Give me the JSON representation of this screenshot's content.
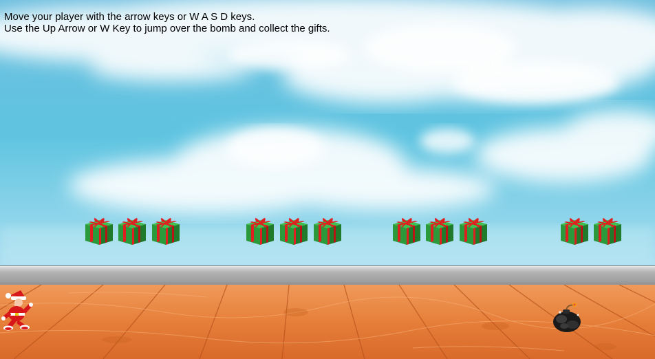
{
  "instructions": {
    "line1": "Move your player with the arrow keys or W A S D keys.",
    "line2": "Use the Up Arrow or W Key to jump over the bomb and collect the gifts."
  },
  "colors": {
    "sky_top": "#7cc4e0",
    "sky_bottom": "#b8e4f0",
    "floor": "#e07a3a",
    "gift_box": "#2a9a3a",
    "gift_ribbon": "#e02020"
  },
  "sprites": {
    "player": "santa-runner-icon",
    "bomb": "bomb-icon",
    "gift": "gift-box-icon"
  }
}
